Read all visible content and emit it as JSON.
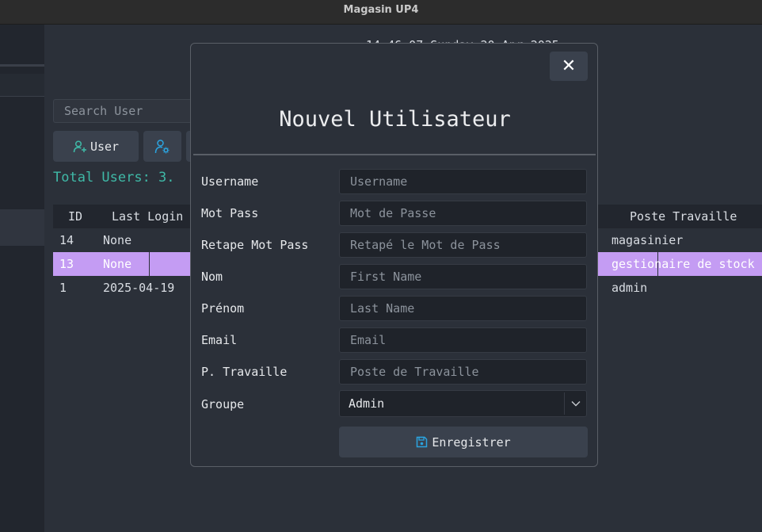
{
  "window": {
    "title": "Magasin UP4"
  },
  "header": {
    "datetime": "14:46:07 Sunday 20 Apr 2025"
  },
  "search": {
    "placeholder": "Search User"
  },
  "toolbar": {
    "add_user_label": "User",
    "add_user_icon": "user-plus-icon",
    "settings_icon": "user-gear-icon"
  },
  "summary": {
    "total_users": "Total Users: 3."
  },
  "table": {
    "columns": {
      "id": "ID",
      "last_login": "Last Login",
      "poste": "Poste Travaille"
    },
    "rows": [
      {
        "id": "14",
        "last_login": "None",
        "poste": "magasinier"
      },
      {
        "id": "13",
        "last_login": "None",
        "poste": "gestionaire de stock",
        "selected": true
      },
      {
        "id": "1",
        "last_login": "2025-04-19",
        "poste": "admin"
      }
    ]
  },
  "dialog": {
    "title": "Nouvel Utilisateur",
    "close_icon": "close-icon",
    "fields": {
      "username": {
        "label": "Username",
        "placeholder": "Username",
        "value": ""
      },
      "password": {
        "label": "Mot Pass",
        "placeholder": "Mot de Passe",
        "value": ""
      },
      "password_confirm": {
        "label": "Retape Mot Pass",
        "placeholder": "Retapé le Mot de Pass",
        "value": ""
      },
      "nom": {
        "label": "Nom",
        "placeholder": "First Name",
        "value": ""
      },
      "prenom": {
        "label": "Prénom",
        "placeholder": "Last Name",
        "value": ""
      },
      "email": {
        "label": "Email",
        "placeholder": "Email",
        "value": ""
      },
      "poste": {
        "label": "P. Travaille",
        "placeholder": "Poste de Travaille",
        "value": ""
      }
    },
    "groupe": {
      "label": "Groupe",
      "selected": "Admin"
    },
    "save_label": "Enregistrer",
    "save_icon": "save-icon"
  },
  "colors": {
    "accent_teal": "#3fb9a7",
    "selection_purple": "#c49cf3",
    "icon_blue": "#2ba4e0",
    "dialog_border": "#5a5f67"
  }
}
